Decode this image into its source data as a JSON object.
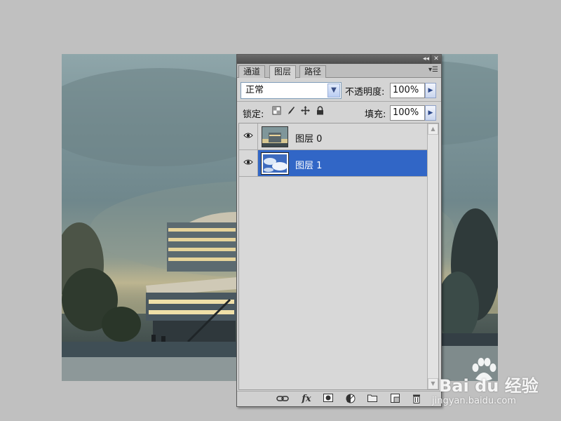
{
  "panel": {
    "tabs": [
      "通道",
      "图层",
      "路径"
    ],
    "active_tab": "图层",
    "blend_mode": "正常",
    "opacity_label": "不透明度:",
    "opacity_value": "100%",
    "lock_label": "锁定:",
    "fill_label": "填充:",
    "fill_value": "100%"
  },
  "layers": [
    {
      "name": "图层 0",
      "visible": true,
      "selected": false
    },
    {
      "name": "图层 1",
      "visible": true,
      "selected": true
    }
  ],
  "bottom_toolbar": {
    "fx_label": "fx"
  },
  "watermark": {
    "brand": "Bai du 经验",
    "url": "jingyan.baidu.com"
  },
  "colors": {
    "selection": "#3166c6",
    "panel_bg": "#d4d4d4",
    "workspace_bg": "#c0c0c0"
  }
}
